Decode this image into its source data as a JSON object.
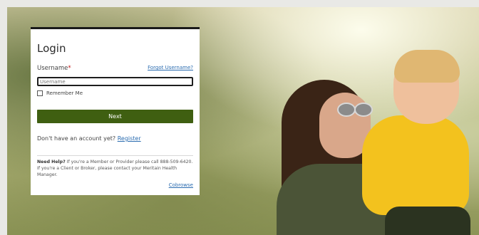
{
  "login": {
    "title": "Login",
    "username_label": "Username",
    "required_mark": "*",
    "forgot_username": "Forgot Username?",
    "username_placeholder": "Username",
    "username_value": "",
    "remember_me": "Remember Me",
    "next_button": "Next",
    "no_account_text": "Don't have an account yet?",
    "register_link": "Register",
    "help_label": "Need Help?",
    "help_text": " If you're a Member or Provider please call 888-509-6420. If you're a Client or Broker, please contact your Meritain Health Manager.",
    "cobrowse": "Cobrowse"
  },
  "colors": {
    "primary_button": "#3f5f11",
    "link": "#2b6cb0",
    "required": "#c01919"
  },
  "icons": {
    "checkbox": "checkbox-unchecked-icon"
  }
}
